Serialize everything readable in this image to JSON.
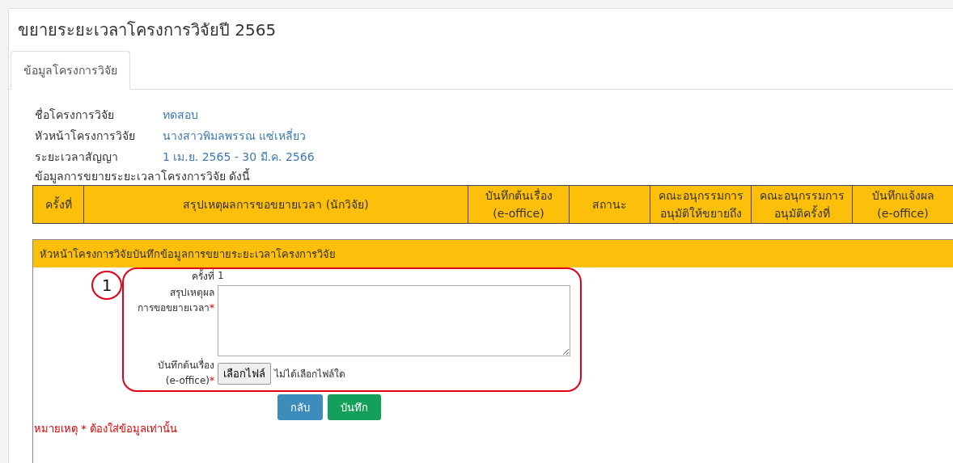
{
  "page": {
    "title": "ขยายระยะเวลาโครงการวิจัยปี 2565"
  },
  "tabs": [
    {
      "label": "ข้อมูลโครงการวิจัย",
      "selected": true
    }
  ],
  "project_info": [
    {
      "label": "ชื่อโครงการวิจัย",
      "value": "ทดสอบ"
    },
    {
      "label": "หัวหน้าโครงการวิจัย",
      "value": "นางสาวพิมลพรรณ แซ่เหลี่ยว"
    },
    {
      "label": "ระยะเวลาสัญญา",
      "value": "1 เม.ย. 2565 - 30 มี.ค. 2566"
    }
  ],
  "table": {
    "caption": "ข้อมูลการขยายระยะเวลาโครงการวิจัย ดังนี้",
    "columns": [
      [
        "ครั้งที่"
      ],
      [
        "สรุปเหตุผลการขอขยายเวลา (นักวิจัย)"
      ],
      [
        "บันทึกต้นเรื่อง",
        "(e-office)"
      ],
      [
        "สถานะ"
      ],
      [
        "คณะอนุกรรมการ",
        "อนุมัติให้ขยายถึง"
      ],
      [
        "คณะอนุกรรมการ",
        "อนุมัติครั้งที่"
      ],
      [
        "บันทึกแจ้งผล",
        "(e-office)"
      ]
    ]
  },
  "form": {
    "header": "หัวหน้าโครงการวิจัยบันทึกข้อมูลการขยายระยะเวลาโครงการวิจัย",
    "annotation": "1",
    "fields": [
      {
        "kind": "text",
        "label": [
          "ครั้งที่"
        ],
        "value": "1"
      },
      {
        "kind": "textarea",
        "label": [
          "สรุปเหตุผล",
          "การขอขยายเวลา"
        ],
        "required_mark": "*"
      },
      {
        "kind": "file",
        "label": [
          "บันทึกต้นเรื่อง",
          "(e-office)"
        ],
        "required_mark": "*",
        "button": "เลือกไฟล์",
        "status": "ไม่ได้เลือกไฟล์ใด"
      }
    ],
    "buttons": [
      {
        "kind": "back",
        "label": "กลับ"
      },
      {
        "kind": "save",
        "label": "บันทึก"
      }
    ],
    "note": "หมายเหตุ * ต้องใส่ข้อมูลเท่านั้น"
  }
}
